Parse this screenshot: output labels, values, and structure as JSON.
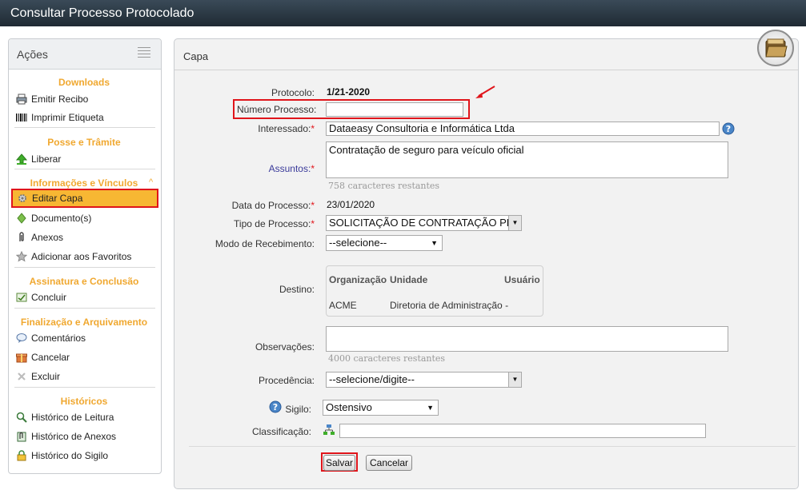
{
  "window": {
    "title": "Consultar Processo Protocolado"
  },
  "sidebar": {
    "title": "Ações",
    "sections": {
      "downloads": "Downloads",
      "posse": "Posse e Trâmite",
      "info": "Informações e Vínculos",
      "assinatura": "Assinatura e Conclusão",
      "finalizacao": "Finalização e Arquivamento",
      "historicos": "Históricos"
    },
    "items": {
      "emitir_recibo": "Emitir Recibo",
      "imprimir_etiqueta": "Imprimir Etiqueta",
      "liberar": "Liberar",
      "editar_capa": "Editar Capa",
      "documentos": "Documento(s)",
      "anexos": "Anexos",
      "favoritos": "Adicionar aos Favoritos",
      "concluir": "Concluir",
      "comentarios": "Comentários",
      "cancelar": "Cancelar",
      "excluir": "Excluir",
      "hist_leitura": "Histórico de Leitura",
      "hist_anexos": "Histórico de Anexos",
      "hist_sigilo": "Histórico do Sigilo"
    }
  },
  "panel": {
    "title": "Capa",
    "fields": {
      "protocolo": {
        "label": "Protocolo:",
        "value": "1/21-2020"
      },
      "numero_processo": {
        "label": "Número Processo:",
        "value": ""
      },
      "interessado": {
        "label": "Interessado:",
        "value": "Dataeasy Consultoria e Informática Ltda"
      },
      "assuntos": {
        "label": "Assuntos:",
        "value": "Contratação de seguro para veículo oficial",
        "hint": "758 caracteres restantes"
      },
      "data_processo": {
        "label": "Data do Processo:",
        "value": "23/01/2020"
      },
      "tipo_processo": {
        "label": "Tipo de Processo:",
        "value": "SOLICITAÇÃO DE CONTRATAÇÃO PR"
      },
      "modo_recebimento": {
        "label": "Modo de Recebimento:",
        "value": "--selecione--"
      },
      "destino": {
        "label": "Destino:",
        "headers": {
          "organizacao": "Organização",
          "unidade": "Unidade",
          "usuario": "Usuário"
        },
        "row": {
          "organizacao": "ACME",
          "unidade": "Diretoria de Administração -",
          "usuario": ""
        }
      },
      "observacoes": {
        "label": "Observações:",
        "value": "",
        "hint": "4000 caracteres restantes"
      },
      "procedencia": {
        "label": "Procedência:",
        "value": "--selecione/digite--"
      },
      "sigilo": {
        "label": "Sigilo:",
        "value": "Ostensivo"
      },
      "classificacao": {
        "label": "Classificação:",
        "value": ""
      }
    },
    "buttons": {
      "salvar": "Salvar",
      "cancelar": "Cancelar"
    }
  },
  "colors": {
    "accent": "#f0a830",
    "highlight": "#f7b733",
    "annotation_red": "#e0151b",
    "titlebar": "#2a3742"
  }
}
